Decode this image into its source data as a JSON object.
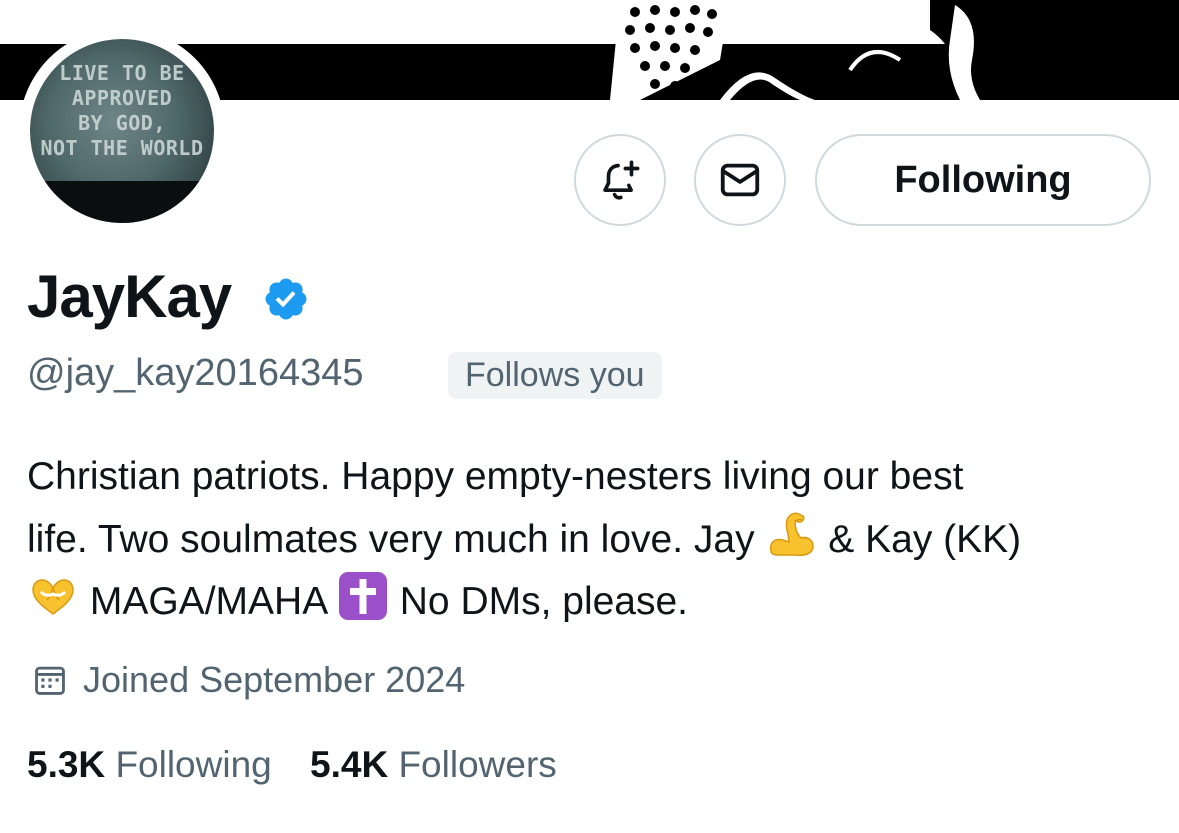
{
  "profile": {
    "display_name": "JayKay",
    "handle": "@jay_kay20164345",
    "follows_you_badge": "Follows you",
    "avatar_text": [
      "LIVE TO BE",
      "APPROVED",
      "BY GOD,",
      "NOT THE WORLD"
    ],
    "bio_lines": [
      "Christian patriots. Happy empty-nesters living our best",
      "life. Two soulmates very much in love. Jay",
      "& Kay (KK)",
      "MAGA/MAHA",
      "No DMs, please."
    ],
    "bio_emojis": [
      "flexed-biceps-emoji",
      "heart-hands-emoji",
      "latin-cross-emoji"
    ],
    "joined": "Joined September 2024",
    "verified": true
  },
  "actions": {
    "notify_icon": "bell-plus-icon",
    "message_icon": "envelope-icon",
    "following_label": "Following"
  },
  "stats": {
    "following_count": "5.3K",
    "following_label": "Following",
    "followers_count": "5.4K",
    "followers_label": "Followers"
  },
  "colors": {
    "text_primary": "#0f1419",
    "text_secondary": "#536471",
    "border": "#cfd9de",
    "verified_blue": "#1d9bf0",
    "badge_bg": "#eff3f4"
  }
}
